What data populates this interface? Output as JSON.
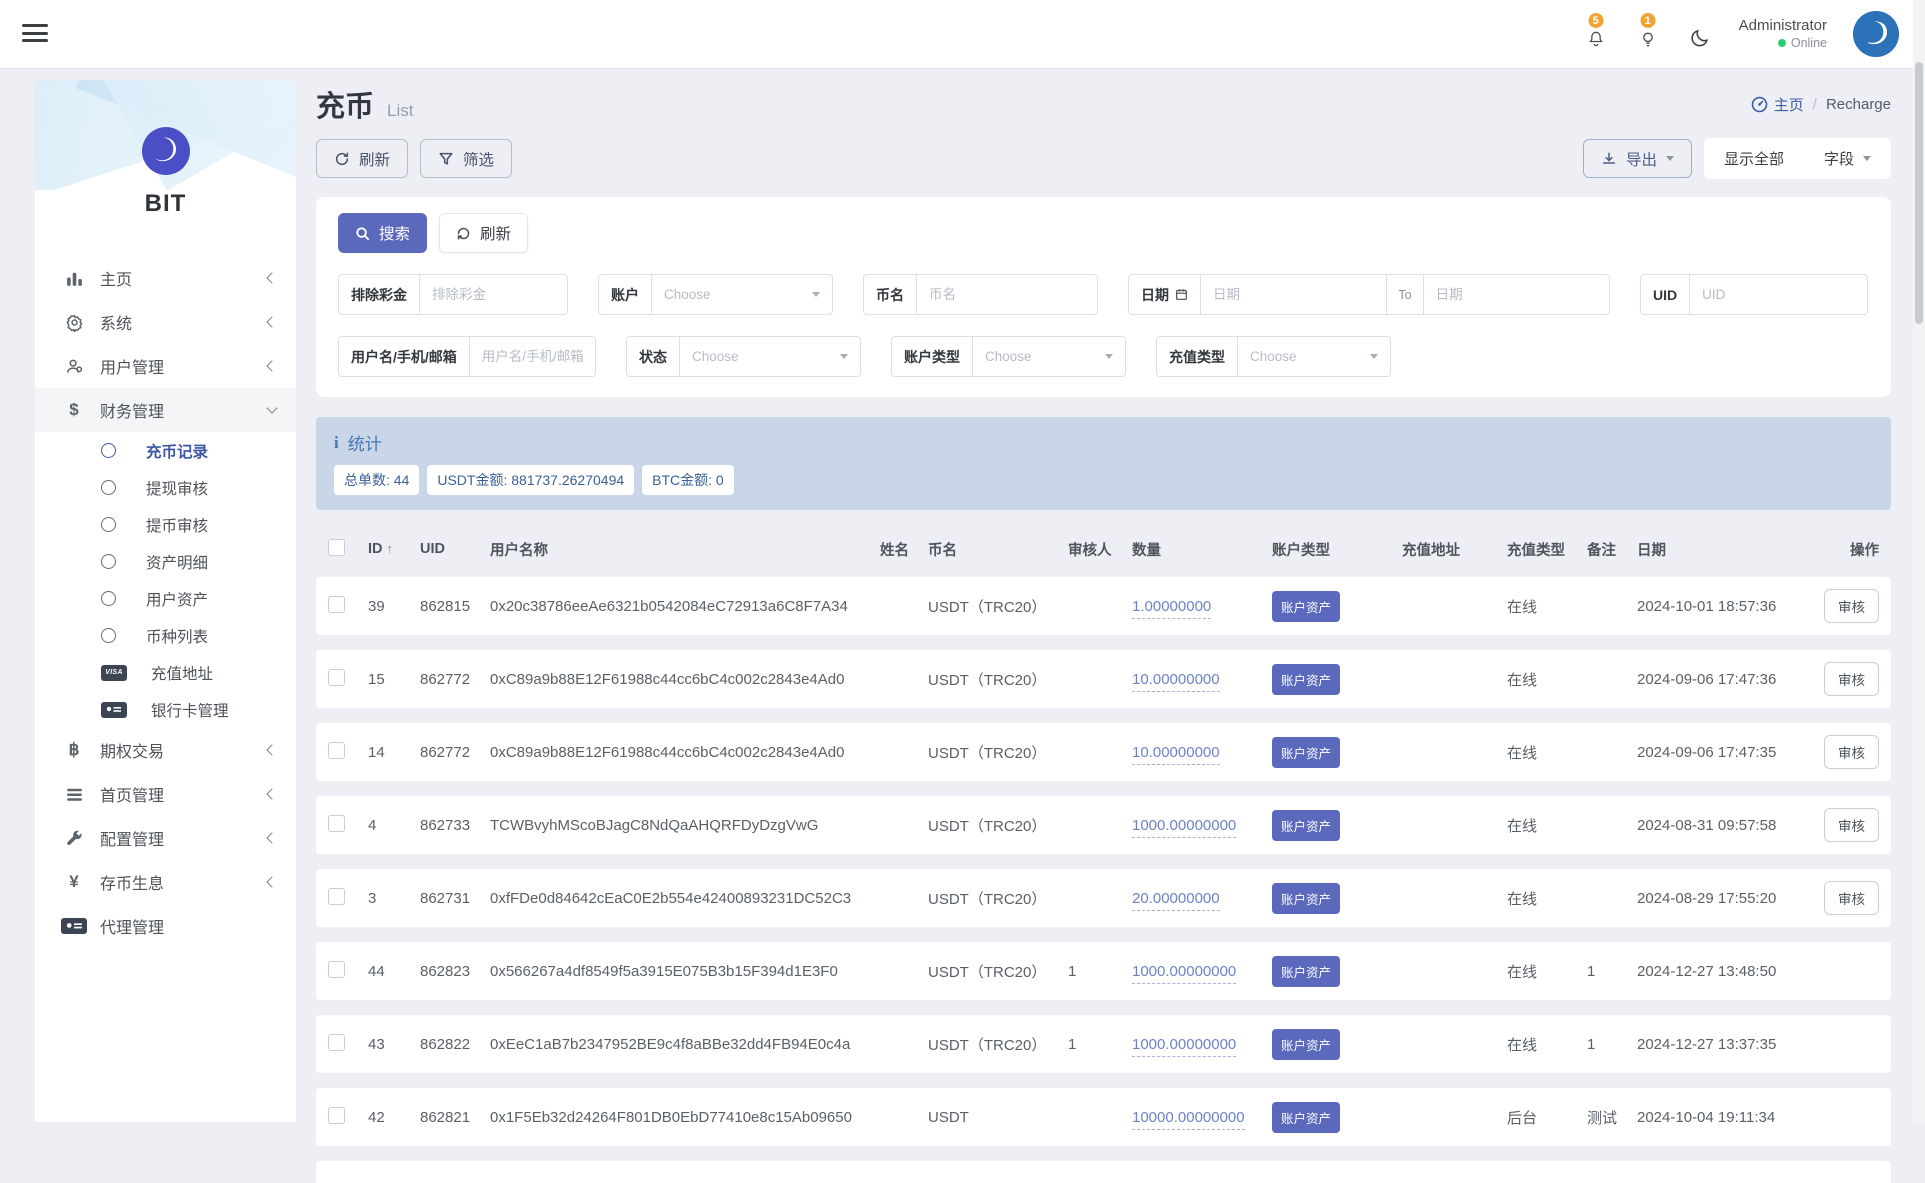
{
  "topbar": {
    "admin_name": "Administrator",
    "online_label": "Online",
    "bell_badge": "5",
    "bulb_badge": "1"
  },
  "sidebar": {
    "logo_text": "BIT",
    "menu": [
      {
        "label": "主页",
        "icon": "bar-chart-icon",
        "type": "parent",
        "chevron": "left"
      },
      {
        "label": "系统",
        "icon": "gear-icon",
        "type": "parent",
        "chevron": "left"
      },
      {
        "label": "用户管理",
        "icon": "users-icon",
        "type": "parent",
        "chevron": "left"
      },
      {
        "label": "财务管理",
        "icon": "dollar-icon",
        "type": "parent",
        "chevron": "down",
        "active": true
      },
      {
        "label": "充币记录",
        "icon": "circle-icon",
        "type": "sub",
        "active": true
      },
      {
        "label": "提现审核",
        "icon": "circle-icon",
        "type": "sub"
      },
      {
        "label": "提币审核",
        "icon": "circle-icon",
        "type": "sub"
      },
      {
        "label": "资产明细",
        "icon": "circle-icon",
        "type": "sub"
      },
      {
        "label": "用户资产",
        "icon": "circle-icon",
        "type": "sub"
      },
      {
        "label": "币种列表",
        "icon": "circle-icon",
        "type": "sub"
      },
      {
        "label": "充值地址",
        "icon": "visa-icon",
        "type": "sub"
      },
      {
        "label": "银行卡管理",
        "icon": "bank-card-icon",
        "type": "sub"
      },
      {
        "label": "期权交易",
        "icon": "bitcoin-icon",
        "type": "parent",
        "chevron": "left"
      },
      {
        "label": "首页管理",
        "icon": "list-icon",
        "type": "parent",
        "chevron": "left"
      },
      {
        "label": "配置管理",
        "icon": "wrench-icon",
        "type": "parent",
        "chevron": "left"
      },
      {
        "label": "存币生息",
        "icon": "yen-icon",
        "type": "parent",
        "chevron": "left"
      },
      {
        "label": "代理管理",
        "icon": "id-card-icon",
        "type": "parent"
      }
    ]
  },
  "page": {
    "title": "充币",
    "subtitle": "List",
    "breadcrumb": {
      "home": "主页",
      "separator": "/",
      "current": "Recharge"
    }
  },
  "toolbar": {
    "refresh": "刷新",
    "filter": "筛选",
    "export": "导出",
    "show_all": "显示全部",
    "fields": "字段"
  },
  "filters": {
    "search_btn": "搜索",
    "reset_btn": "刷新",
    "choose": "Choose",
    "rows": [
      [
        {
          "label": "排除彩金",
          "type": "text",
          "placeholder": "排除彩金"
        },
        {
          "label": "账户",
          "type": "select",
          "value": "Choose"
        },
        {
          "label": "币名",
          "type": "text",
          "placeholder": "币名"
        },
        {
          "label": "日期",
          "type": "daterange",
          "placeholder": "日期",
          "to_label": "To",
          "placeholder2": "日期"
        },
        {
          "label": "UID",
          "type": "text",
          "placeholder": "UID"
        }
      ],
      [
        {
          "label": "用户名/手机/邮箱",
          "type": "text",
          "placeholder": "用户名/手机/邮箱"
        },
        {
          "label": "状态",
          "type": "select",
          "value": "Choose"
        },
        {
          "label": "账户类型",
          "type": "select",
          "value": "Choose"
        },
        {
          "label": "充值类型",
          "type": "select",
          "value": "Choose"
        }
      ]
    ]
  },
  "stats": {
    "title": "统计",
    "pills": [
      "总单数: 44",
      "USDT金额: 881737.26270494",
      "BTC金额: 0"
    ]
  },
  "table": {
    "headers": [
      "ID",
      "UID",
      "用户名称",
      "姓名",
      "币名",
      "审核人",
      "数量",
      "账户类型",
      "充值地址",
      "充值类型",
      "备注",
      "日期",
      "操作"
    ],
    "action_label": "审核",
    "rows": [
      {
        "id": "39",
        "uid": "862815",
        "username": "0x20c38786eeAe6321b0542084eC72913a6C8F7A34",
        "realname": "",
        "coin": "USDT（TRC20）",
        "reviewer": "",
        "amount": "1.00000000",
        "account_type": "账户资产",
        "recharge_address": "",
        "recharge_type": "在线",
        "remark": "",
        "date": "2024-10-01 18:57:36",
        "has_action": true
      },
      {
        "id": "15",
        "uid": "862772",
        "username": "0xC89a9b88E12F61988c44cc6bC4c002c2843e4Ad0",
        "realname": "",
        "coin": "USDT（TRC20）",
        "reviewer": "",
        "amount": "10.00000000",
        "account_type": "账户资产",
        "recharge_address": "",
        "recharge_type": "在线",
        "remark": "",
        "date": "2024-09-06 17:47:36",
        "has_action": true
      },
      {
        "id": "14",
        "uid": "862772",
        "username": "0xC89a9b88E12F61988c44cc6bC4c002c2843e4Ad0",
        "realname": "",
        "coin": "USDT（TRC20）",
        "reviewer": "",
        "amount": "10.00000000",
        "account_type": "账户资产",
        "recharge_address": "",
        "recharge_type": "在线",
        "remark": "",
        "date": "2024-09-06 17:47:35",
        "has_action": true
      },
      {
        "id": "4",
        "uid": "862733",
        "username": "TCWBvyhMScoBJagC8NdQaAHQRFDyDzgVwG",
        "realname": "",
        "coin": "USDT（TRC20）",
        "reviewer": "",
        "amount": "1000.00000000",
        "account_type": "账户资产",
        "recharge_address": "",
        "recharge_type": "在线",
        "remark": "",
        "date": "2024-08-31 09:57:58",
        "has_action": true
      },
      {
        "id": "3",
        "uid": "862731",
        "username": "0xfFDe0d84642cEaC0E2b554e42400893231DC52C3",
        "realname": "",
        "coin": "USDT（TRC20）",
        "reviewer": "",
        "amount": "20.00000000",
        "account_type": "账户资产",
        "recharge_address": "",
        "recharge_type": "在线",
        "remark": "",
        "date": "2024-08-29 17:55:20",
        "has_action": true
      },
      {
        "id": "44",
        "uid": "862823",
        "username": "0x566267a4df8549f5a3915E075B3b15F394d1E3F0",
        "realname": "",
        "coin": "USDT（TRC20）",
        "reviewer": "1",
        "amount": "1000.00000000",
        "account_type": "账户资产",
        "recharge_address": "",
        "recharge_type": "在线",
        "remark": "1",
        "date": "2024-12-27 13:48:50",
        "has_action": false
      },
      {
        "id": "43",
        "uid": "862822",
        "username": "0xEeC1aB7b2347952BE9c4f8aBBe32dd4FB94E0c4a",
        "realname": "",
        "coin": "USDT（TRC20）",
        "reviewer": "1",
        "amount": "1000.00000000",
        "account_type": "账户资产",
        "recharge_address": "",
        "recharge_type": "在线",
        "remark": "1",
        "date": "2024-12-27 13:37:35",
        "has_action": false
      },
      {
        "id": "42",
        "uid": "862821",
        "username": "0x1F5Eb32d24264F801DB0EbD77410e8c15Ab09650",
        "realname": "",
        "coin": "USDT",
        "reviewer": "",
        "amount": "10000.00000000",
        "account_type": "账户资产",
        "recharge_address": "",
        "recharge_type": "后台",
        "remark": "测试",
        "date": "2024-10-04 19:11:34",
        "has_action": false
      }
    ]
  },
  "colors": {
    "primary": "#5b69bd",
    "stats_bg": "#c9d6e8",
    "stats_text": "#3d6195",
    "link_blue": "#3c5da5",
    "amount_blue": "#6e82c8",
    "badge_orange": "#efa434",
    "online_green": "#2ecc71"
  }
}
